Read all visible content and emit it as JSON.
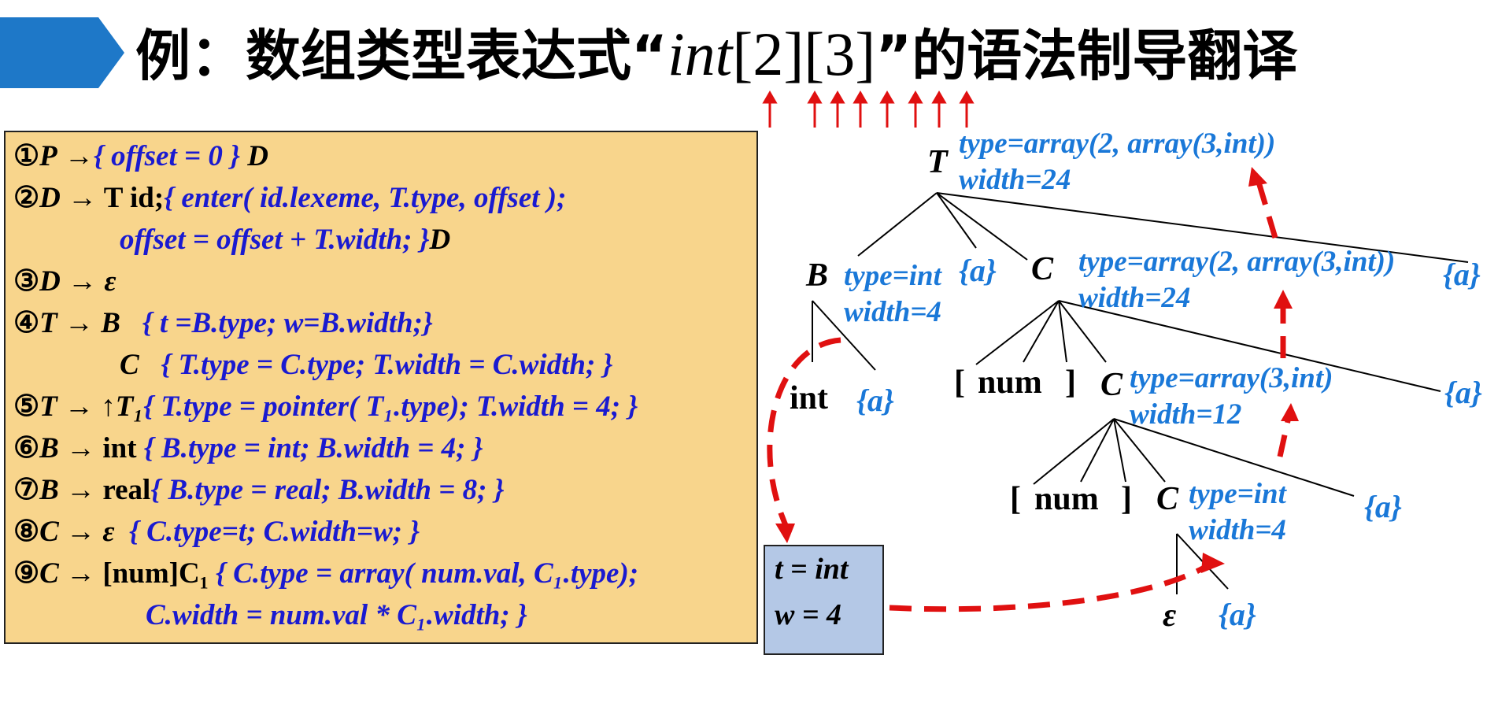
{
  "title": {
    "prefix": "例：数组类型表达式“",
    "tok_int": "int",
    "tok_dims": "[2][3]",
    "suffix": "”的语法制导翻译"
  },
  "rules": [
    {
      "num": "①",
      "head": "P",
      "arrow": "→",
      "body": "",
      "action": "{ offset = 0 }",
      "after": " D"
    },
    {
      "num": "②",
      "head": "D",
      "arrow": "→",
      "body": "T id;",
      "action": "{ enter( id.lexeme, T.type, offset );",
      "after": ""
    },
    {
      "num": "",
      "head": "",
      "arrow": "",
      "body": "",
      "action": "offset = offset + T.width; }",
      "after": "D"
    },
    {
      "num": "③",
      "head": "D",
      "arrow": "→",
      "body": "ε",
      "action": "",
      "after": ""
    },
    {
      "num": "④",
      "head": "T",
      "arrow": "→",
      "body": "B",
      "action": "{ t =B.type; w=B.width;}",
      "after": ""
    },
    {
      "num": "",
      "head": "",
      "arrow": "",
      "body": "C",
      "action": "{ T.type = C.type; T.width = C.width; }",
      "after": ""
    },
    {
      "num": "⑤",
      "head": "T",
      "arrow": "→",
      "body": "↑T₁",
      "action": "{ T.type = pointer( T₁.type); T.width = 4; }",
      "after": ""
    },
    {
      "num": "⑥",
      "head": "B",
      "arrow": "→",
      "body": "int",
      "action": "{ B.type = int; B.width = 4; }",
      "after": ""
    },
    {
      "num": "⑦",
      "head": "B",
      "arrow": "→",
      "body": "real",
      "action": "{ B.type = real; B.width = 8; }",
      "after": ""
    },
    {
      "num": "⑧",
      "head": "C",
      "arrow": "→",
      "body": "ε",
      "action": "{ C.type=t; C.width=w; }",
      "after": ""
    },
    {
      "num": "⑨",
      "head": "C",
      "arrow": "→",
      "body": "[num]C₁",
      "action": "{ C.type = array( num.val, C₁.type);",
      "after": ""
    },
    {
      "num": "",
      "head": "",
      "arrow": "",
      "body": "",
      "action": "C.width = num.val * C₁.width; }",
      "after": ""
    }
  ],
  "tree": {
    "nodes": {
      "T": "T",
      "B": "B",
      "C1": "C",
      "C2": "C",
      "C3": "C",
      "int": "int",
      "lbr1": "[",
      "num1": "num",
      "rbr1": "]",
      "lbr2": "[",
      "num2": "num",
      "rbr2": "]",
      "eps": "ε"
    },
    "actions": {
      "a": "{a}"
    },
    "annotations": {
      "T_type": "type=array(2, array(3,int))",
      "T_width": "width=24",
      "B_type": "type=int",
      "B_width": "width=4",
      "C1_type": "type=array(2, array(3,int))",
      "C1_width": "width=24",
      "C2_type": "type=array(3,int)",
      "C2_width": "width=12",
      "C3_type": "type=int",
      "C3_width": "width=4"
    }
  },
  "inherited_box": {
    "t": "t = int",
    "w": "w = 4"
  },
  "colors": {
    "banner": "#1e78c8",
    "rules_bg": "#f8d58c",
    "action_blue": "#1a1ad0",
    "annotation_blue": "#1a78d8",
    "red": "#e01010",
    "box_bg": "#b4c8e6"
  }
}
